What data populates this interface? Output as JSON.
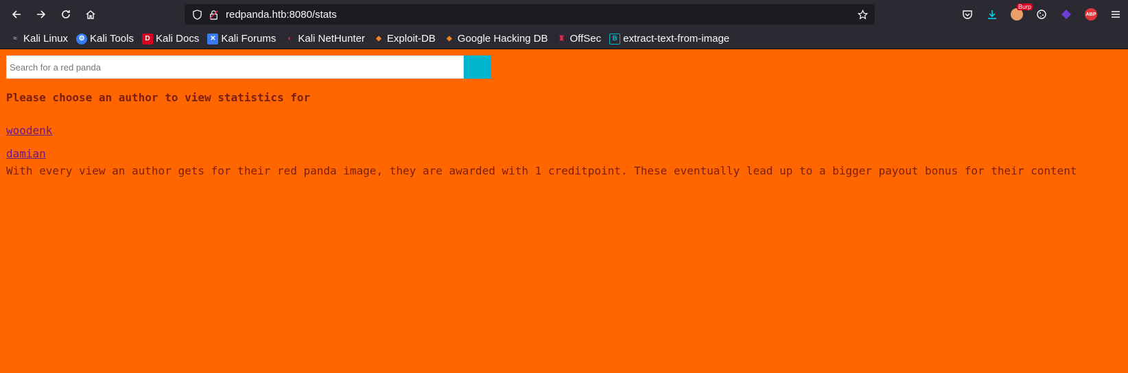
{
  "browser": {
    "url": "redpanda.htb:8080/stats",
    "bookmarks": [
      {
        "label": "Kali Linux",
        "icon": "kali-dragon-icon"
      },
      {
        "label": "Kali Tools",
        "icon": "kali-tools-icon"
      },
      {
        "label": "Kali Docs",
        "icon": "kali-docs-icon"
      },
      {
        "label": "Kali Forums",
        "icon": "kali-forums-icon"
      },
      {
        "label": "Kali NetHunter",
        "icon": "nethunter-icon"
      },
      {
        "label": "Exploit-DB",
        "icon": "exploit-db-icon"
      },
      {
        "label": "Google Hacking DB",
        "icon": "ghdb-icon"
      },
      {
        "label": "OffSec",
        "icon": "offsec-icon"
      },
      {
        "label": "extract-text-from-image",
        "icon": "bookmark-b-icon"
      }
    ],
    "burp_badge": "Burp",
    "abp_label": "ABP"
  },
  "page": {
    "search_placeholder": "Search for a red panda",
    "heading": "Please choose an author to view statistics for",
    "authors": [
      "woodenk",
      "damian"
    ],
    "description": "With every view an author gets for their red panda image, they are awarded with 1 creditpoint. These eventually lead up to a bigger payout bonus for their content",
    "colors": {
      "background": "#ff6600",
      "search_button": "#00b5cc"
    }
  }
}
